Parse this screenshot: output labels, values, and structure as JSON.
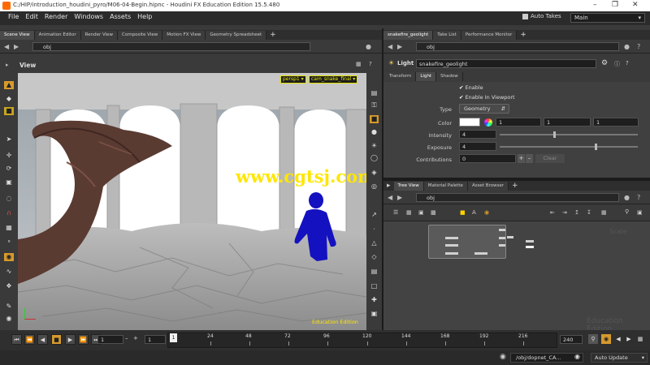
{
  "window": {
    "title": "C:/HIP/introduction_houdini_pyro/M06-04-Begin.hipnc - Houdini FX Education Edition 15.5.480"
  },
  "menu": {
    "items": [
      "File",
      "Edit",
      "Render",
      "Windows",
      "Assets",
      "Help"
    ],
    "auto_takes": "Auto Takes",
    "desktop": "Main"
  },
  "left_pane": {
    "tabs": [
      "Scene View",
      "Animation Editor",
      "Render View",
      "Composite View",
      "Motion FX View",
      "Geometry Spreadsheet"
    ],
    "path": "obj",
    "view_label": "View",
    "camera": "persp1",
    "cam_name": "cam_snake_final",
    "watermark": "www.cgtsj.com",
    "edition_badge": "Education Edition"
  },
  "param_pane": {
    "tabs": [
      "snakefire_geolight",
      "Take List",
      "Performance Monitor"
    ],
    "path": "obj",
    "node_type": "Light",
    "node_name": "snakefire_geolight",
    "sub_tabs": [
      "Transform",
      "Light",
      "Shadow"
    ],
    "enable": "Enable",
    "enable_viewport": "Enable In Viewport",
    "type_label": "Type",
    "type_value": "Geometry",
    "color_label": "Color",
    "color_values": [
      "1",
      "1",
      "1"
    ],
    "intensity_label": "Intensity",
    "intensity_value": "4",
    "exposure_label": "Exposure",
    "exposure_value": "4",
    "contributions_label": "Contributions",
    "contributions_value": "0",
    "clear": "Clear"
  },
  "network_pane": {
    "tabs": [
      "Tree View",
      "Material Palette",
      "Asset Browser"
    ],
    "path": "obj",
    "corner_label": "Scale",
    "edition_watermark": "Education Edition"
  },
  "timeline": {
    "start_field": "1",
    "frame_field": "1",
    "current_frame": "1",
    "ticks": [
      "24",
      "48",
      "72",
      "96",
      "120",
      "144",
      "168",
      "192",
      "216"
    ],
    "end_field": "240"
  },
  "status": {
    "path": "/obj/dopnet_CA...",
    "update_mode": "Auto Update"
  },
  "colors": {
    "accent": "#ff9f1c",
    "watermark": "#ffe600",
    "character": "#1411c0",
    "snake": "#5a3b32"
  }
}
